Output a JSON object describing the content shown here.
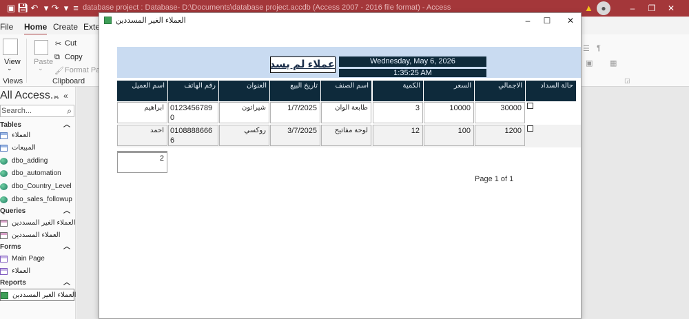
{
  "app": {
    "title": "database project : Database- D:\\Documents\\database project.accdb (Access 2007 - 2016 file format)  -  Access",
    "quick_access": [
      "save-icon",
      "undo-icon",
      "redo-icon",
      "customize-icon"
    ],
    "colors": {
      "titlebar": "#a4373a",
      "report_header": "#c9dbf1",
      "column_header": "#0e2a3b"
    }
  },
  "ribbon": {
    "tabs": [
      "File",
      "Home",
      "Create",
      "Exter"
    ],
    "active_tab": "Home",
    "views_label": "View",
    "views_group": "Views",
    "paste_label": "Paste",
    "cut_label": "Cut",
    "copy_label": "Copy",
    "format_painter_label": "Format Pain",
    "clipboard_group": "Clipboard"
  },
  "nav": {
    "title": "All Access...",
    "search_placeholder": "Search...",
    "groups": {
      "tables": "Tables",
      "queries": "Queries",
      "forms": "Forms",
      "reports": "Reports"
    },
    "tables": [
      "العملاء",
      "المبيعات",
      "dbo_adding",
      "dbo_automation",
      "dbo_Country_Level",
      "dbo_sales_followup"
    ],
    "queries": [
      "العملاء الغير المسددين",
      "العملاء المسددين"
    ],
    "forms": [
      "Main Page",
      "العملاء"
    ],
    "reports": [
      "العملاء الغير المسددين"
    ]
  },
  "report_window": {
    "title": "العملاء الغير المسددين",
    "heading": "عملاء لم يسددو",
    "date": "Wednesday, May 6, 2026",
    "time": "1:35:25 AM",
    "columns": [
      "حالة السداد",
      "الاجمالي",
      "السعر",
      "الكمية",
      "اسم الصنف",
      "تاريخ البيع",
      "العنوان",
      "رقم الهاتف",
      "اسم العميل"
    ],
    "rows": [
      {
        "total": "30000",
        "price": "10000",
        "qty": "3",
        "item": "طابعة الوان",
        "date": "1/7/2025",
        "address": "شيراتون",
        "phone": "01234567890",
        "customer": "ابراهيم"
      },
      {
        "total": "1200",
        "price": "100",
        "qty": "12",
        "item": "لوحة مفاتيح",
        "date": "3/7/2025",
        "address": "روكسي",
        "phone": "01088886666",
        "customer": "احمد"
      }
    ],
    "record_count": "2",
    "page_label": "Page 1 of 1"
  }
}
